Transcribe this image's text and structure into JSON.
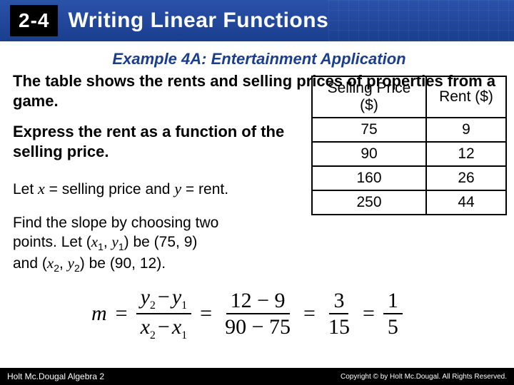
{
  "header": {
    "badge": "2-4",
    "title": "Writing Linear Functions"
  },
  "example": "Example 4A: Entertainment Application",
  "prompt": "The table shows the rents and selling prices of properties from a game.",
  "subprompt": "Express the rent as a function of the selling price.",
  "letline": {
    "pre": "Let ",
    "x": "x",
    "mid": " = selling price and ",
    "y": "y",
    "post": " = rent."
  },
  "find": {
    "l1": "Find the slope by choosing two",
    "l2a": "points. Let (",
    "x1": "x",
    "s1": "1",
    "c1": ", ",
    "y1": "y",
    "s1b": "1",
    "l2b": ") be  (75, 9)",
    "l3a": "and (",
    "x2": "x",
    "s2": "2",
    "c2": ", ",
    "y2": "y",
    "s2b": "2",
    "l3b": ") be (90, 12)."
  },
  "table": {
    "head": [
      "Selling Price ($)",
      "Rent ($)"
    ],
    "rows": [
      [
        "75",
        "9"
      ],
      [
        "90",
        "12"
      ],
      [
        "160",
        "26"
      ],
      [
        "250",
        "44"
      ]
    ]
  },
  "eq": {
    "m": "m",
    "eq": "=",
    "f1t_a": "y",
    "f1t_as": "2",
    "f1t_m": "−",
    "f1t_b": "y",
    "f1t_bs": "1",
    "f1b_a": "x",
    "f1b_as": "2",
    "f1b_m": "−",
    "f1b_b": "x",
    "f1b_bs": "1",
    "f2t": "12 − 9",
    "f2b": "90 − 75",
    "f3t": "3",
    "f3b": "15",
    "f4t": "1",
    "f4b": "5"
  },
  "footer": {
    "left": "Holt Mc.Dougal Algebra 2",
    "right": "Copyright © by Holt Mc.Dougal. All Rights Reserved."
  }
}
